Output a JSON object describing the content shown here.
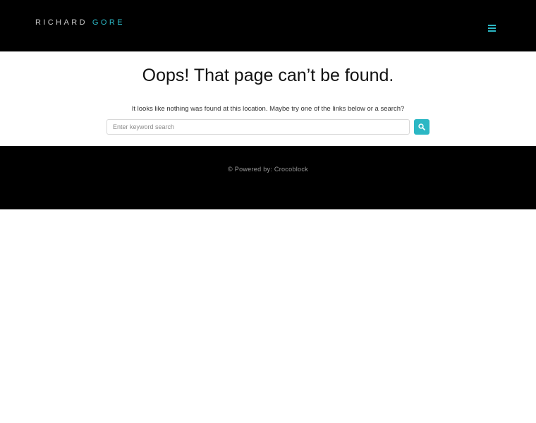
{
  "header": {
    "logo_first": "RICHARD",
    "logo_last": "GORE",
    "menu_icon": "hamburger-icon"
  },
  "main": {
    "title": "Oops! That page can’t be found.",
    "message": "It looks like nothing was found at this location. Maybe try one of the links below or a search?",
    "search": {
      "placeholder": "Enter keyword search",
      "value": "",
      "button_icon": "search-icon"
    }
  },
  "footer": {
    "copyright": "© Powered by: Crocoblock"
  },
  "colors": {
    "accent": "#2bb7c4",
    "header_bg": "#000000",
    "footer_bg": "#000000",
    "text": "#111111"
  }
}
